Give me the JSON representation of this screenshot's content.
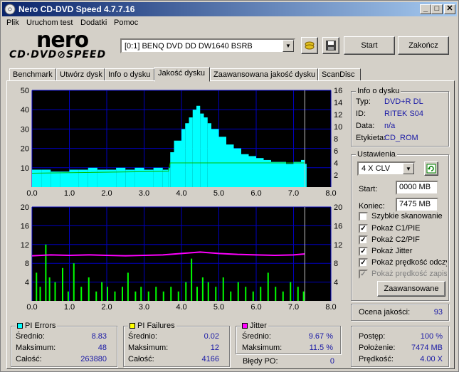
{
  "window": {
    "title": "Nero CD-DVD Speed 4.7.7.16",
    "min": "_",
    "max": "□",
    "close": "✕"
  },
  "menu": [
    "Plik",
    "Uruchom test",
    "Dodatki",
    "Pomoc"
  ],
  "logo": {
    "top": "nero",
    "bottom": "CD·DVD⊘SPEED"
  },
  "drive": {
    "selected": "[0:1]   BENQ DVD DD DW1640 BSRB"
  },
  "buttons": {
    "start": "Start",
    "close": "Zakończ",
    "advanced": "Zaawansowane"
  },
  "tabs": [
    "Benchmark",
    "Utwórz dysk",
    "Info o dysku",
    "Jakość dysku",
    "Zaawansowana jakość dysku",
    "ScanDisc"
  ],
  "active_tab": 3,
  "disc_info": {
    "title": "Info o dysku",
    "rows": [
      {
        "label": "Typ:",
        "value": "DVD+R DL"
      },
      {
        "label": "ID:",
        "value": "RITEK S04"
      },
      {
        "label": "Data:",
        "value": "n/a"
      },
      {
        "label": "Etykieta:",
        "value": "CD_ROM"
      }
    ]
  },
  "settings": {
    "title": "Ustawienia",
    "speed": "4 X CLV",
    "start_label": "Start:",
    "start_value": "0000 MB",
    "end_label": "Koniec:",
    "end_value": "7475 MB",
    "checkboxes": [
      {
        "label": "Szybkie skanowanie",
        "checked": false,
        "disabled": false
      },
      {
        "label": "Pokaż C1/PIE",
        "checked": true,
        "disabled": false
      },
      {
        "label": "Pokaż C2/PIF",
        "checked": true,
        "disabled": false
      },
      {
        "label": "Pokaż Jitter",
        "checked": true,
        "disabled": false
      },
      {
        "label": "Pokaż prędkość odczytu",
        "checked": true,
        "disabled": false
      },
      {
        "label": "Pokaż prędkość zapisu",
        "checked": true,
        "disabled": true
      }
    ]
  },
  "quality": {
    "label": "Ocena jakości:",
    "value": "93"
  },
  "pi_errors": {
    "title": "PI Errors",
    "color": "#00ffff",
    "rows": [
      {
        "label": "Średnio:",
        "value": "8.83"
      },
      {
        "label": "Maksimum:",
        "value": "48"
      },
      {
        "label": "Całość:",
        "value": "263880"
      }
    ]
  },
  "pi_failures": {
    "title": "PI Failures",
    "color": "#ffff00",
    "rows": [
      {
        "label": "Średnio:",
        "value": "0.02"
      },
      {
        "label": "Maksimum:",
        "value": "12"
      },
      {
        "label": "Całość:",
        "value": "4166"
      }
    ]
  },
  "jitter": {
    "title": "Jitter",
    "color": "#ff00ff",
    "rows": [
      {
        "label": "Średnio:",
        "value": "9.67 %"
      },
      {
        "label": "Maksimum:",
        "value": "11.5 %"
      }
    ]
  },
  "po_errors": {
    "label": "Błędy PO:",
    "value": "0"
  },
  "progress": {
    "rows": [
      {
        "label": "Postęp:",
        "value": "100 %"
      },
      {
        "label": "Położenie:",
        "value": "7474 MB"
      },
      {
        "label": "Prędkość:",
        "value": "4.00 X"
      }
    ]
  },
  "chart_data": [
    {
      "type": "area",
      "x_ticks": [
        "0.0",
        "1.0",
        "2.0",
        "3.0",
        "4.0",
        "5.0",
        "6.0",
        "7.0",
        "8.0"
      ],
      "y_left_ticks": [
        "50",
        "40",
        "30",
        "20",
        "10"
      ],
      "y_right_ticks": [
        "16",
        "14",
        "12",
        "10",
        "8",
        "6",
        "4",
        "2"
      ],
      "xlim": [
        0,
        8
      ],
      "ylim": [
        0,
        50
      ],
      "y2lim": [
        0,
        16
      ],
      "series": [
        {
          "color": "#00ffff",
          "x": [
            0,
            0.25,
            0.5,
            0.75,
            1,
            1.25,
            1.5,
            1.75,
            2,
            2.25,
            2.5,
            2.75,
            3,
            3.25,
            3.5,
            3.65,
            3.7,
            3.8,
            4,
            4.1,
            4.2,
            4.3,
            4.4,
            4.5,
            4.6,
            4.7,
            4.8,
            5,
            5.2,
            5.4,
            5.6,
            5.8,
            6,
            6.2,
            6.4,
            6.6,
            6.8,
            7,
            7.2,
            7.3
          ],
          "values": [
            9,
            9,
            8,
            8,
            9,
            9,
            10,
            9,
            9,
            10,
            9,
            10,
            9,
            10,
            9,
            10,
            18,
            24,
            30,
            33,
            36,
            40,
            42,
            38,
            36,
            33,
            30,
            26,
            22,
            20,
            17,
            16,
            15,
            14,
            13,
            13,
            12,
            13,
            14,
            12
          ]
        },
        {
          "color": "#00c000",
          "axis": "right",
          "x": [
            0,
            3.65,
            3.7,
            7.3
          ],
          "values": [
            2.3,
            2.6,
            4,
            4
          ]
        }
      ]
    },
    {
      "type": "bar",
      "x_ticks": [
        "0.0",
        "1.0",
        "2.0",
        "3.0",
        "4.0",
        "5.0",
        "6.0",
        "7.0",
        "8.0"
      ],
      "y_left_ticks": [
        "20",
        "16",
        "12",
        "8",
        "4"
      ],
      "y_right_ticks": [
        "20",
        "16",
        "12",
        "8",
        "4"
      ],
      "xlim": [
        0,
        8
      ],
      "ylim": [
        0,
        20
      ],
      "series": [
        {
          "color": "#00ff00",
          "x": [
            0.1,
            0.2,
            0.35,
            0.45,
            0.6,
            0.8,
            0.95,
            1.1,
            1.3,
            1.5,
            1.7,
            1.85,
            2.0,
            2.2,
            2.4,
            2.55,
            2.75,
            2.9,
            3.1,
            3.3,
            3.5,
            3.7,
            3.9,
            4.1,
            4.25,
            4.4,
            4.55,
            4.7,
            4.9,
            5.1,
            5.3,
            5.5,
            5.7,
            5.9,
            6.1,
            6.3,
            6.5,
            6.7,
            6.9,
            7.1,
            7.25
          ],
          "values": [
            6,
            3,
            12,
            5,
            4,
            7,
            2,
            8,
            3,
            5,
            2,
            4,
            3,
            2,
            3,
            6,
            2,
            3,
            2,
            3,
            2,
            3,
            2,
            4,
            9,
            3,
            5,
            4,
            3,
            5,
            2,
            4,
            3,
            2,
            3,
            6,
            3,
            2,
            4,
            3,
            2
          ]
        },
        {
          "color": "#ff00ff",
          "x": [
            0,
            0.5,
            1,
            1.5,
            2,
            2.5,
            3,
            3.5,
            4,
            4.5,
            5,
            5.5,
            6,
            6.5,
            7,
            7.3
          ],
          "values": [
            9.6,
            9.8,
            9.7,
            9.8,
            9.7,
            9.6,
            9.7,
            9.8,
            10.1,
            10.4,
            10.1,
            9.9,
            9.8,
            9.7,
            9.8,
            10.0
          ]
        }
      ]
    }
  ]
}
